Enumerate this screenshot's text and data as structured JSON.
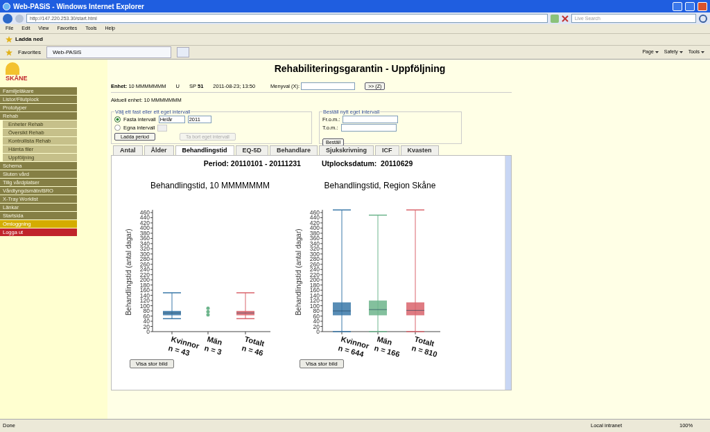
{
  "browser": {
    "title": "Web-PASiS - Windows Internet Explorer",
    "address": "http://147.220.253.30/start.html",
    "search_placeholder": "Live Search",
    "menu": [
      "File",
      "Edit",
      "View",
      "Favorites",
      "Tools",
      "Help"
    ],
    "links_bar": "Ladda ned",
    "favorites": "Favorites",
    "tab": "Web-PASiS",
    "toolbar": [
      "Page",
      "Safety",
      "Tools"
    ]
  },
  "logo": "SKÅNE",
  "sidebar": [
    {
      "label": "Familjeläkare",
      "kind": "main"
    },
    {
      "label": "Listor/Filutplock",
      "kind": "main"
    },
    {
      "label": "Prototyper",
      "kind": "main"
    },
    {
      "label": "Rehab",
      "kind": "main"
    },
    {
      "label": "Enheter Rehab",
      "kind": "sub"
    },
    {
      "label": "Översikt Rehab",
      "kind": "sub"
    },
    {
      "label": "Kontrollista Rehab",
      "kind": "sub"
    },
    {
      "label": "Hämta filer",
      "kind": "sub"
    },
    {
      "label": "Uppföljning",
      "kind": "sub"
    },
    {
      "label": "Schema",
      "kind": "main"
    },
    {
      "label": "Sluten vård",
      "kind": "main"
    },
    {
      "label": "Tillg vårdplatser",
      "kind": "main"
    },
    {
      "label": "Vårdtyngdsmätn/BRO",
      "kind": "main"
    },
    {
      "label": "X-Tray Worklist",
      "kind": "main"
    },
    {
      "label": "Länkar",
      "kind": "main"
    },
    {
      "label": "Startsida",
      "kind": "main"
    },
    {
      "label": "Omloggning",
      "kind": "highlight"
    },
    {
      "label": "Logga ut",
      "kind": "logout"
    }
  ],
  "page_title": "Rehabiliteringsgarantin - Uppföljning",
  "info": {
    "enhet_label": "Enhet:",
    "enhet": "10 MMMMMMM",
    "u": "U",
    "sp_label": "SP",
    "sp": "51",
    "datetime": "2011-08-23; 13:50",
    "menyval_label": "Menyval (X):",
    "go_button": ">> (Z)"
  },
  "aktuell": "Aktuell enhet: 10 MMMMMMM",
  "interval": {
    "legend": "Välj ett fast eller ett eget intervall",
    "options": [
      {
        "label": "Fasta intervall",
        "selected": true
      },
      {
        "label": "Egna intervall",
        "selected": false
      }
    ],
    "period_select": "Helår",
    "year_select": "2011",
    "load_button": "Ladda period",
    "remove_button": "Ta bort eget intervall"
  },
  "order": {
    "legend": "Beställ nytt eget intervall",
    "from_label": "Fr.o.m.:",
    "to_label": "T.o.m.:",
    "button": "Beställ"
  },
  "tabs": [
    {
      "label": "Antal",
      "selected": false
    },
    {
      "label": "Ålder",
      "selected": false
    },
    {
      "label": "Behandlingstid",
      "selected": true
    },
    {
      "label": "EQ-5D",
      "selected": false
    },
    {
      "label": "Behandlare",
      "selected": false
    },
    {
      "label": "Sjukskrivning",
      "selected": false
    },
    {
      "label": "ICF",
      "selected": false
    },
    {
      "label": "Kvasten",
      "selected": false
    }
  ],
  "period": "Period: 20110101 - 20111231",
  "utplock": "Utplocksdatum:  20110629",
  "plots": [
    {
      "title": "Behandlingstid, 10 MMMMMMM",
      "ylabel": "Behandlingstid (antal dagar)",
      "yticks": [
        "460",
        "440",
        "420",
        "400",
        "380",
        "360",
        "340",
        "320",
        "300",
        "280",
        "260",
        "240",
        "220",
        "200",
        "180",
        "160",
        "140",
        "120",
        "100",
        "80",
        "60",
        "40",
        "20",
        "0"
      ],
      "groups": [
        {
          "label": "Kvinnor",
          "count": "n = 43"
        },
        {
          "label": "Män",
          "count": "n = 3"
        },
        {
          "label": "Totalt",
          "count": "n = 46"
        }
      ],
      "button": "Visa stor bild"
    },
    {
      "title": "Behandlingstid, Region Skåne",
      "ylabel": "Behandlingstid (antal dagar)",
      "yticks": [
        "460",
        "440",
        "420",
        "400",
        "380",
        "360",
        "340",
        "320",
        "300",
        "280",
        "260",
        "240",
        "220",
        "200",
        "180",
        "160",
        "140",
        "120",
        "100",
        "80",
        "60",
        "40",
        "20",
        "0"
      ],
      "groups": [
        {
          "label": "Kvinnor",
          "count": "n = 644"
        },
        {
          "label": "Män",
          "count": "n = 166"
        },
        {
          "label": "Totalt",
          "count": "n = 810"
        }
      ],
      "button": "Visa stor bild"
    }
  ],
  "status": {
    "text": "Done",
    "zone": "Local intranet",
    "zoom": "100%"
  }
}
